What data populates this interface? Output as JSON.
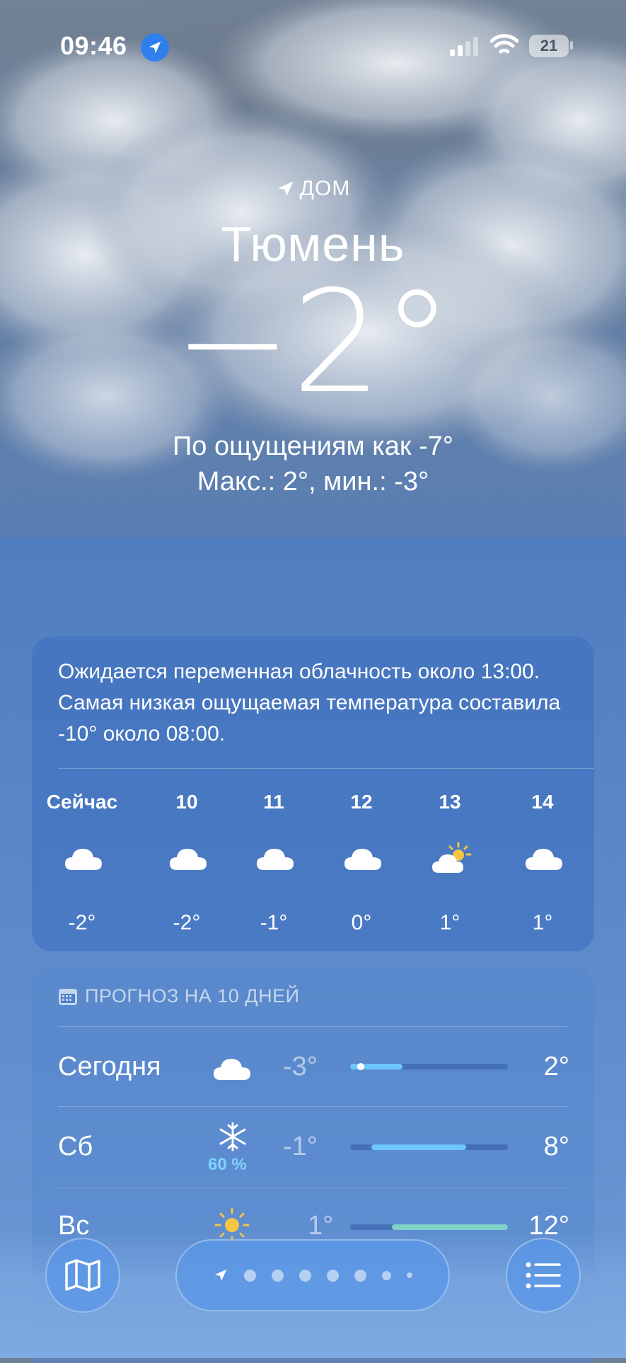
{
  "status_bar": {
    "time": "09:46",
    "battery": "21"
  },
  "header": {
    "home_label": "ДОМ",
    "city": "Тюмень",
    "temperature": "−2°",
    "feels_like": "По ощущениям как -7°",
    "min_max": "Макс.: 2°, мин.: -3°"
  },
  "hourly": {
    "summary": "Ожидается переменная облачность около 13:00. Самая низкая ощущаемая температура составила -10° около 08:00.",
    "hours": [
      {
        "label": "Сейчас",
        "icon": "cloud-icon",
        "temp": "-2°"
      },
      {
        "label": "10",
        "icon": "cloud-icon",
        "temp": "-2°"
      },
      {
        "label": "11",
        "icon": "cloud-icon",
        "temp": "-1°"
      },
      {
        "label": "12",
        "icon": "cloud-icon",
        "temp": "0°"
      },
      {
        "label": "13",
        "icon": "partly-sunny-icon",
        "temp": "1°"
      },
      {
        "label": "14",
        "icon": "cloud-icon",
        "temp": "1°"
      }
    ]
  },
  "forecast": {
    "title": "ПРОГНОЗ НА 10 ДНЕЙ",
    "range_min": -3,
    "range_max": 12,
    "days": [
      {
        "day": "Сегодня",
        "icon": "cloud-icon",
        "precip": "",
        "low": "-3°",
        "high": "2°",
        "low_v": -3,
        "high_v": 2,
        "current_v": -2
      },
      {
        "day": "Сб",
        "icon": "snowflake-icon",
        "precip": "60 %",
        "low": "-1°",
        "high": "8°",
        "low_v": -1,
        "high_v": 8
      },
      {
        "day": "Вс",
        "icon": "sun-icon",
        "precip": "",
        "low": "1°",
        "high": "12°",
        "low_v": 1,
        "high_v": 12
      }
    ]
  },
  "colors": {
    "accent": "#2f80ed",
    "precip": "#7fd3ff",
    "bar_cold": "#6ec6ff",
    "bar_warm": "#7fd1c6"
  }
}
